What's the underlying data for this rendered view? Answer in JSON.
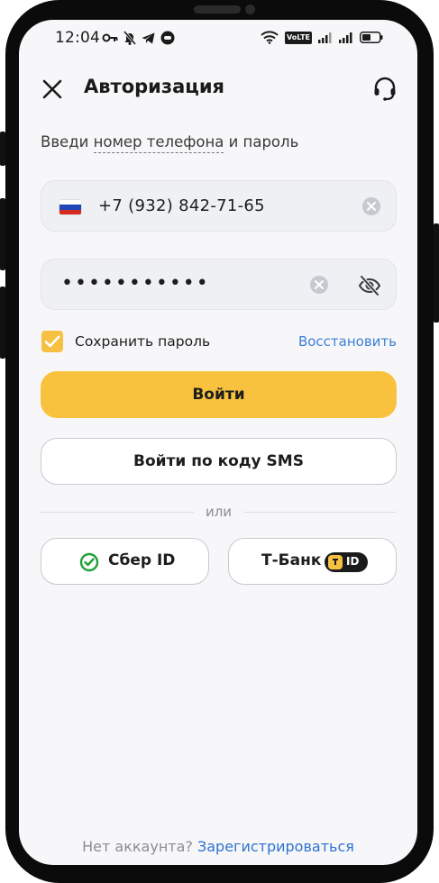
{
  "status_bar": {
    "time": "12:04",
    "left_icons": [
      "key-icon",
      "bell-off-icon",
      "telegram-icon",
      "chat-bubble-icon"
    ],
    "right_icons": [
      "wifi-icon",
      "volte-icon",
      "signal-icon",
      "signal-icon",
      "battery-icon"
    ],
    "volte_label": "VoLTE"
  },
  "header": {
    "title": "Авторизация",
    "close_icon": "close-icon",
    "support_icon": "headset-icon"
  },
  "subtitle": {
    "prefix": "Введи ",
    "link": "номер телефона",
    "suffix": " и пароль"
  },
  "phone_field": {
    "country_flag": "russia-flag",
    "value": "+7 (932) 842-71-65",
    "flag_colors": [
      "#ffffff",
      "#1f47b8",
      "#d52b1e"
    ]
  },
  "password_field": {
    "value": "•••••••••••",
    "visibility_icon": "eye-off-icon"
  },
  "remember": {
    "label": "Сохранить пароль",
    "checked": true,
    "restore_link": "Восстановить"
  },
  "buttons": {
    "login": "Войти",
    "sms_login": "Войти по коду SMS"
  },
  "divider": {
    "text": "или"
  },
  "alt_logins": {
    "sber": "Сбер ID",
    "tbank": "Т-Банк",
    "tbank_badge": "ID"
  },
  "footer": {
    "question": "Нет аккаунта?",
    "register_link": "Зарегистрироваться"
  },
  "colors": {
    "accent_yellow": "#f8c23e",
    "link_blue": "#3d7fd6",
    "sber_green": "#21a038"
  }
}
